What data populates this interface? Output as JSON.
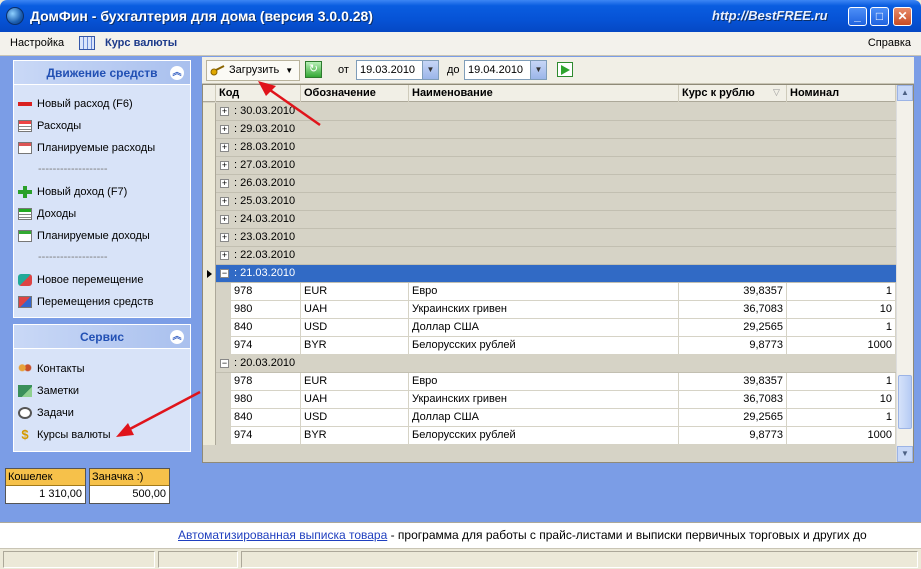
{
  "window": {
    "title": "ДомФин - бухгалтерия для дома (версия 3.0.0.28)",
    "watermark": "http://BestFREE.ru"
  },
  "menu": {
    "settings": "Настройка",
    "current": "Курс валюты",
    "help": "Справка"
  },
  "sidebar": {
    "moves_title": "Движение средств",
    "moves_items": [
      {
        "label": "Новый расход (F6)",
        "icon": "minus-icon"
      },
      {
        "label": "Расходы",
        "icon": "expenses-icon"
      },
      {
        "label": "Планируемые расходы",
        "icon": "planned-expenses-icon"
      },
      {
        "label": "Новый доход (F7)",
        "icon": "plus-icon"
      },
      {
        "label": "Доходы",
        "icon": "income-icon"
      },
      {
        "label": "Планируемые доходы",
        "icon": "planned-income-icon"
      },
      {
        "label": "Новое перемещение",
        "icon": "transfer-icon"
      },
      {
        "label": "Перемещения средств",
        "icon": "transfers-icon"
      }
    ],
    "separator": "-------------------",
    "service_title": "Сервис",
    "service_items": [
      {
        "label": "Контакты",
        "icon": "contacts-icon"
      },
      {
        "label": "Заметки",
        "icon": "notes-icon"
      },
      {
        "label": "Задачи",
        "icon": "tasks-icon"
      },
      {
        "label": "Курсы валюты",
        "icon": "dollar-icon"
      }
    ]
  },
  "wallets": [
    {
      "name": "Кошелек",
      "amount": "1 310,00"
    },
    {
      "name": "Заначка :)",
      "amount": "500,00"
    }
  ],
  "toolbar": {
    "load": "Загрузить",
    "from_label": "от",
    "from_date": "19.03.2010",
    "to_label": "до",
    "to_date": "19.04.2010"
  },
  "grid": {
    "columns": [
      "Код",
      "Обозначение",
      "Наименование",
      "Курс к рублю",
      "Номинал"
    ],
    "collapsed_groups": [
      ": 30.03.2010",
      ": 29.03.2010",
      ": 28.03.2010",
      ": 27.03.2010",
      ": 26.03.2010",
      ": 25.03.2010",
      ": 24.03.2010",
      ": 23.03.2010",
      ": 22.03.2010"
    ],
    "expanded_groups": [
      {
        "label": ": 21.03.2010",
        "selected": true,
        "rows": [
          [
            "978",
            "EUR",
            "Евро",
            "39,8357",
            "1"
          ],
          [
            "980",
            "UAH",
            "Украинских гривен",
            "36,7083",
            "10"
          ],
          [
            "840",
            "USD",
            "Доллар США",
            "29,2565",
            "1"
          ],
          [
            "974",
            "BYR",
            "Белорусских рублей",
            "9,8773",
            "1000"
          ]
        ]
      },
      {
        "label": ": 20.03.2010",
        "selected": false,
        "rows": [
          [
            "978",
            "EUR",
            "Евро",
            "39,8357",
            "1"
          ],
          [
            "980",
            "UAH",
            "Украинских гривен",
            "36,7083",
            "10"
          ],
          [
            "840",
            "USD",
            "Доллар США",
            "29,2565",
            "1"
          ],
          [
            "974",
            "BYR",
            "Белорусских рублей",
            "9,8773",
            "1000"
          ]
        ]
      }
    ]
  },
  "footer": {
    "ad_link": "Автоматизированная выписка товара",
    "ad_text": " - программа для работы с прайс-листами и выписки первичных торговых и других до"
  },
  "colors": {
    "workarea": "#7b9de6",
    "selected_row": "#316ac5",
    "annotation_arrow": "#e0141b"
  }
}
